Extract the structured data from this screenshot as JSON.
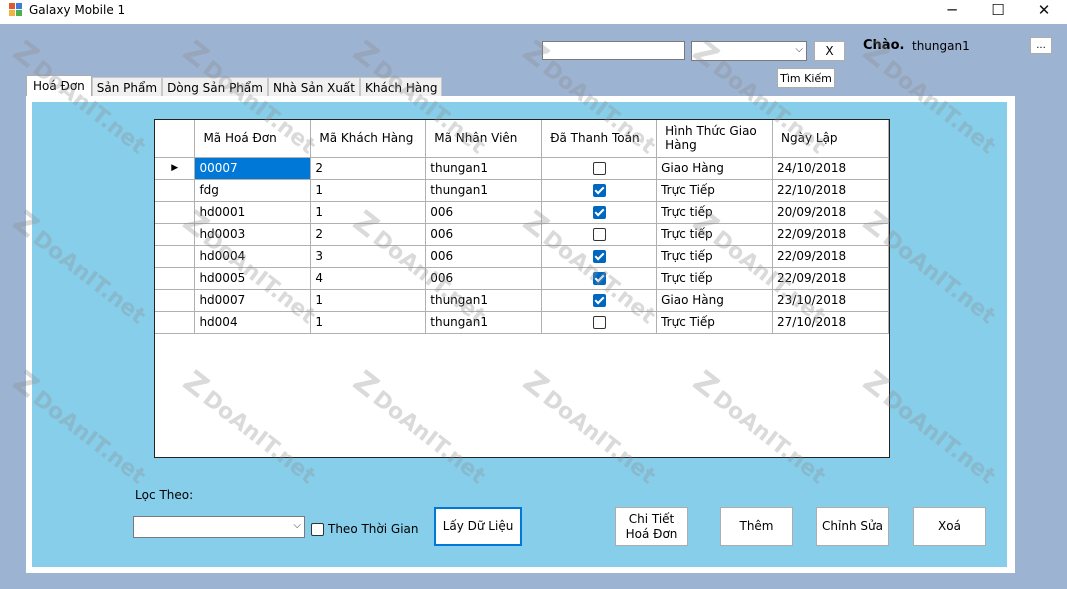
{
  "window": {
    "title": "Galaxy Mobile 1",
    "minimize": "─",
    "maximize": "☐",
    "close": "✕"
  },
  "header": {
    "search_value": "",
    "combo_value": "",
    "clear_label": "X",
    "search_label": "Tìm Kiếm",
    "greeting": "Chào.",
    "username": "thungan1",
    "more_label": "..."
  },
  "tabs": [
    {
      "label": "Hoá Đơn",
      "active": true
    },
    {
      "label": "Sản Phẩm"
    },
    {
      "label": "Dòng Sản Phẩm"
    },
    {
      "label": "Nhà Sản Xuất"
    },
    {
      "label": "Khách Hàng"
    }
  ],
  "grid": {
    "columns": [
      "Mã Hoá Đơn",
      "Mã Khách Hàng",
      "Mã Nhân Viên",
      "Đã Thanh Toán",
      "Hình Thức Giao Hàng",
      "Ngày Lập"
    ],
    "current_row_marker": "▶",
    "rows": [
      {
        "ma_hd": "00007",
        "ma_kh": "2",
        "ma_nv": "thungan1",
        "paid": false,
        "hinh_thuc": "Giao Hàng",
        "ngay": "24/10/2018"
      },
      {
        "ma_hd": "fdg",
        "ma_kh": "1",
        "ma_nv": "thungan1",
        "paid": true,
        "hinh_thuc": "Trực Tiếp",
        "ngay": "22/10/2018"
      },
      {
        "ma_hd": "hd0001",
        "ma_kh": "1",
        "ma_nv": "006",
        "paid": true,
        "hinh_thuc": "Trực tiếp",
        "ngay": "20/09/2018"
      },
      {
        "ma_hd": "hd0003",
        "ma_kh": "2",
        "ma_nv": "006",
        "paid": false,
        "hinh_thuc": "Trực tiếp",
        "ngay": "22/09/2018"
      },
      {
        "ma_hd": "hd0004",
        "ma_kh": "3",
        "ma_nv": "006",
        "paid": true,
        "hinh_thuc": "Trực tiếp",
        "ngay": "22/09/2018"
      },
      {
        "ma_hd": "hd0005",
        "ma_kh": "4",
        "ma_nv": "006",
        "paid": true,
        "hinh_thuc": "Trực tiếp",
        "ngay": "22/09/2018"
      },
      {
        "ma_hd": "hd0007",
        "ma_kh": "1",
        "ma_nv": "thungan1",
        "paid": true,
        "hinh_thuc": "Giao Hàng",
        "ngay": "23/10/2018"
      },
      {
        "ma_hd": "hd004",
        "ma_kh": "1",
        "ma_nv": "thungan1",
        "paid": false,
        "hinh_thuc": "Trực Tiếp",
        "ngay": "27/10/2018"
      }
    ]
  },
  "filter": {
    "label": "Lọc Theo:",
    "combo_value": "",
    "time_check_label": "Theo Thời Gian",
    "time_checked": false
  },
  "actions": {
    "load": "Lấy Dữ Liệu",
    "detail": "Chi Tiết Hoá Đơn",
    "add": "Thêm",
    "edit": "Chỉnh Sửa",
    "delete": "Xoá"
  },
  "watermark": "DoAnIT.net"
}
